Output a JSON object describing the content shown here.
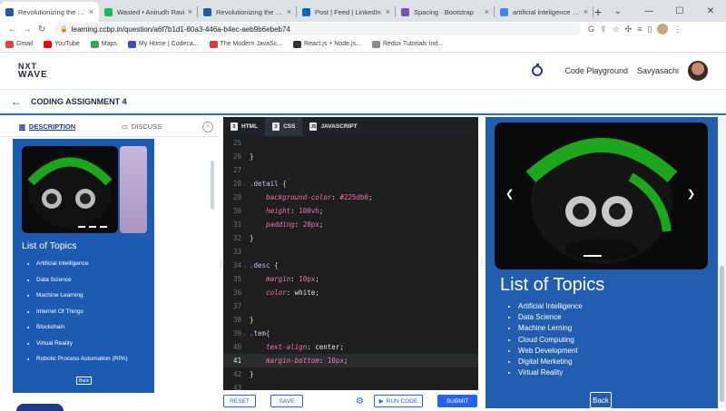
{
  "browser": {
    "tabs": [
      {
        "title": "Revolutionizing the Job Ma",
        "active": true,
        "color": "#1d5bb3"
      },
      {
        "title": "Wasted • Anirudh Ravi",
        "active": false,
        "color": "#1db954"
      },
      {
        "title": "Revolutionizing the Job Ma",
        "active": false,
        "color": "#1d5bb3"
      },
      {
        "title": "Post | Feed | LinkedIn",
        "active": false,
        "color": "#0a66c2"
      },
      {
        "title": "Spacing · Bootstrap",
        "active": false,
        "color": "#7952b3"
      },
      {
        "title": "artificial inteligence - Goog",
        "active": false,
        "color": "#4285f4"
      }
    ],
    "url": "learning.ccbp.in/question/a6f7b1d1-80a3-446a-b4ec-aeb9b6ebeb74",
    "bookmarks": [
      {
        "label": "Gmail",
        "color": "#ea4335"
      },
      {
        "label": "YouTube",
        "color": "#ff0000"
      },
      {
        "label": "Maps",
        "color": "#34a853"
      },
      {
        "label": "My Home | Codeca...",
        "color": "#3f51b5"
      },
      {
        "label": "The Modern JavaSc...",
        "color": "#e53935"
      },
      {
        "label": "React.js + Node.js...",
        "color": "#333333"
      },
      {
        "label": "Redux Tutorials Ind...",
        "color": "#888888"
      }
    ]
  },
  "app": {
    "logo_line1": "NXT",
    "logo_line2": "WAVE",
    "code_playground": "Code Playground",
    "username": "Savyasachi",
    "assignment_title": "CODING ASSIGNMENT 4"
  },
  "left_panel": {
    "tab_description": "DESCRIPTION",
    "tab_discuss": "DISCUSS",
    "preview_title": "List of Topics",
    "topics": [
      "Artificial Intelligence",
      "Data Science",
      "Machine Learning",
      "Internet Of Things",
      "Blockchain",
      "Virtual Reality",
      "Robotic Process Automation (RPA)"
    ],
    "back_label": "Back"
  },
  "editor": {
    "tabs": [
      {
        "label": "HTML",
        "badge": "5"
      },
      {
        "label": "CSS",
        "badge": "3"
      },
      {
        "label": "JAVASCRIPT",
        "badge": "JS"
      }
    ],
    "lines": [
      {
        "n": "25",
        "text": ""
      },
      {
        "n": "26",
        "text": "}"
      },
      {
        "n": "27",
        "text": ""
      },
      {
        "n": "28",
        "text": ".detail {",
        "fold": true
      },
      {
        "n": "29",
        "text": "    background-color: #225db0;"
      },
      {
        "n": "30",
        "text": "    height: 100vh;"
      },
      {
        "n": "31",
        "text": "    padding: 20px;"
      },
      {
        "n": "32",
        "text": "}"
      },
      {
        "n": "33",
        "text": ""
      },
      {
        "n": "34",
        "text": ".desc {",
        "fold": true
      },
      {
        "n": "35",
        "text": "    margin: 10px;"
      },
      {
        "n": "36",
        "text": "    color: white;"
      },
      {
        "n": "37",
        "text": ""
      },
      {
        "n": "38",
        "text": "}"
      },
      {
        "n": "39",
        "text": ".tem{",
        "fold": true
      },
      {
        "n": "40",
        "text": "    text-align: center;"
      },
      {
        "n": "41",
        "text": "    margin-bottom: 10px;",
        "current": true
      },
      {
        "n": "42",
        "text": "}"
      },
      {
        "n": "43",
        "text": ""
      }
    ],
    "reset": "RESET",
    "save": "SAVE",
    "run": "RUN CODE",
    "submit": "SUBMIT"
  },
  "preview": {
    "title": "List of Topics",
    "topics": [
      "Artificial Intelligence",
      "Data Science",
      "Machine Lerning",
      "Cloud Computing",
      "Web Development",
      "Digital Merketing",
      "Virtual Reality"
    ],
    "back_label": "Back"
  }
}
